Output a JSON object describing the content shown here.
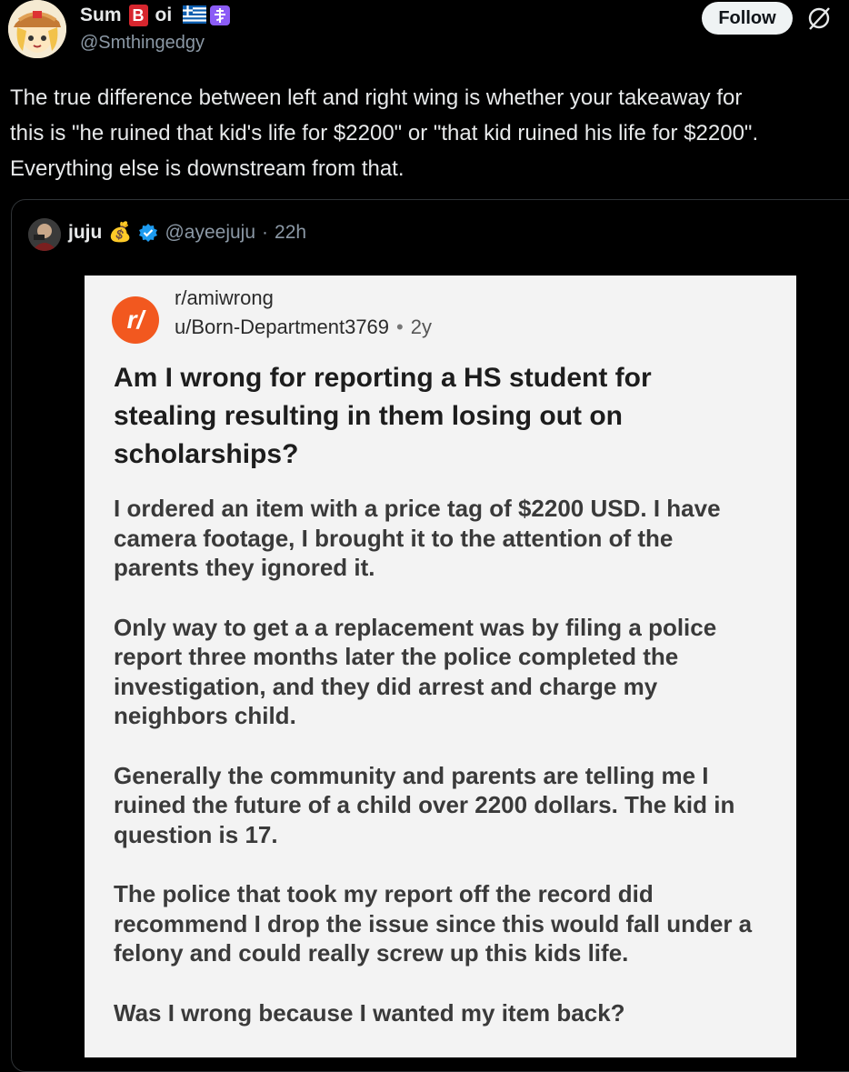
{
  "tweet": {
    "display_name_start": "Sum",
    "display_name_badge": "B",
    "display_name_end": "oi",
    "flag_emojis": "🇬🇷☦️",
    "handle": "@Smthingedgy",
    "follow_label": "Follow",
    "text_lines": [
      "The true difference between left and right wing is whether your takeaway for",
      "this is \"he ruined that kid's life for $2200\" or \"that kid ruined his life for $2200\".",
      "Everything else is downstream from that."
    ]
  },
  "quote": {
    "name": "juju",
    "name_emoji": "💰",
    "handle": "@ayeejuju",
    "separator": "·",
    "age": "22h",
    "verified_color": "#1d9bf0"
  },
  "reddit": {
    "subreddit": "r/amiwrong",
    "author": "u/Born-Department3769",
    "dot": "•",
    "age": "2y",
    "logo_text": "r/",
    "title_lines": [
      "Am I wrong for reporting a HS student for",
      "stealing resulting in them losing out on",
      "scholarships?"
    ],
    "paragraphs": [
      [
        "I ordered an item with a price tag of $2200 USD. I have",
        "camera footage, I brought it to the attention of the",
        "parents they ignored it."
      ],
      [
        "Only way to get a a replacement was by filing a police",
        "report three months later the police completed the",
        "investigation, and they did arrest and charge my",
        "neighbors child."
      ],
      [
        "Generally the community and parents are telling me I",
        "ruined the future of a child over 2200 dollars. The kid in",
        "question is 17."
      ],
      [
        "The police that took my report off the record did",
        "recommend I drop the issue since this would fall under a",
        "felony and could really screw up this kids life."
      ],
      [
        "Was I wrong because I wanted my item back?"
      ]
    ]
  },
  "colors": {
    "background": "#000000",
    "text_primary": "#e7e9ea",
    "text_secondary": "#8b98a5",
    "reddit_orange": "#f2581f",
    "badge_red": "#d7262e"
  }
}
